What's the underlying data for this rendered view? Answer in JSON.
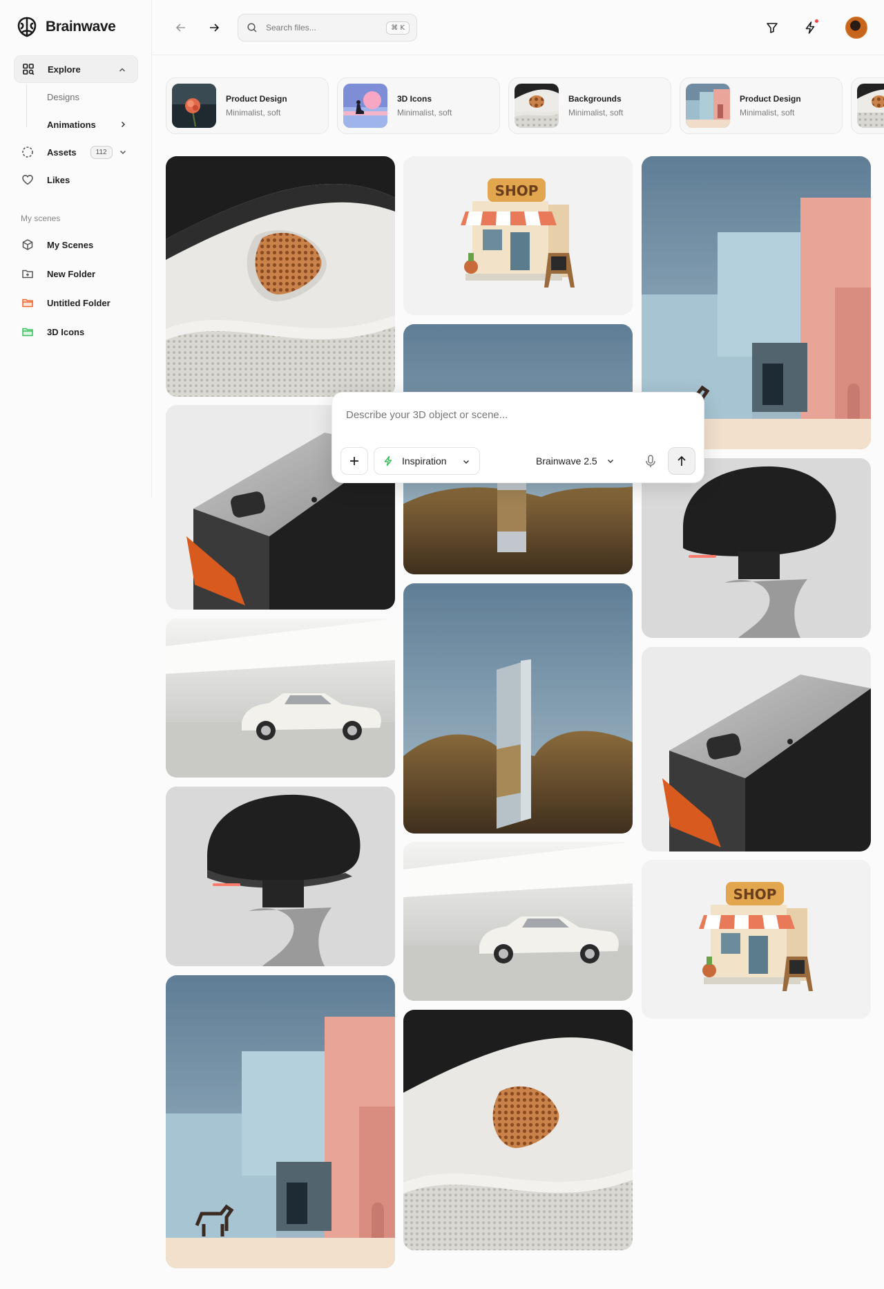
{
  "app": {
    "name": "Brainwave"
  },
  "sidebar": {
    "explore": "Explore",
    "designs": "Designs",
    "animations": "Animations",
    "assets": "Assets",
    "assets_count": "112",
    "likes": "Likes",
    "section_label": "My scenes",
    "scenes": [
      {
        "label": "My Scenes",
        "icon": "cube-icon"
      },
      {
        "label": "New Folder",
        "icon": "folder-plus-icon"
      },
      {
        "label": "Untitled Folder",
        "icon": "folder-icon",
        "color": "#f0642e"
      },
      {
        "label": "3D Icons",
        "icon": "folder-icon",
        "color": "#3bbf5c"
      }
    ]
  },
  "header": {
    "search_placeholder": "Search files...",
    "shortcut": "⌘ K"
  },
  "categories": [
    {
      "title": "Product Design",
      "subtitle": "Minimalist, soft",
      "thumb": "flower"
    },
    {
      "title": "3D Icons",
      "subtitle": "Minimalist, soft",
      "thumb": "sunset"
    },
    {
      "title": "Backgrounds",
      "subtitle": "Minimalist, soft",
      "thumb": "fabric"
    },
    {
      "title": "Product Design",
      "subtitle": "Minimalist, soft",
      "thumb": "buildings"
    },
    {
      "title": "",
      "subtitle": "",
      "thumb": "fabric"
    }
  ],
  "prompt": {
    "placeholder": "Describe your 3D object or scene...",
    "inspiration": "Inspiration",
    "model": "Brainwave 2.5"
  },
  "colors": {
    "accent_orange": "#f0642e",
    "accent_green": "#3bbf5c"
  }
}
